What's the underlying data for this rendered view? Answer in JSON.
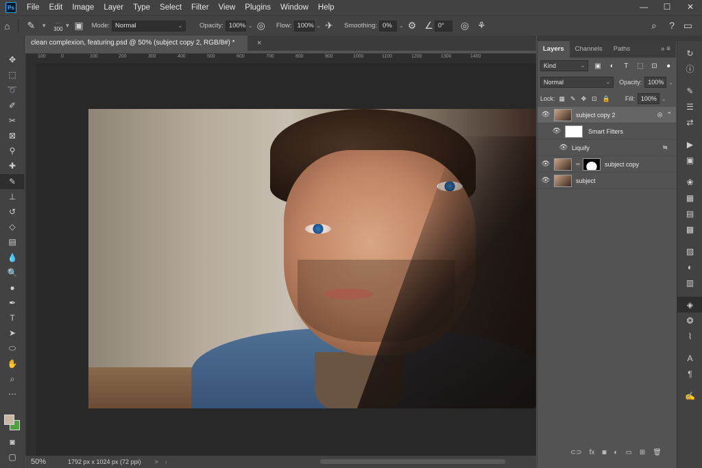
{
  "app": {
    "logo": "Ps"
  },
  "menu": [
    "File",
    "Edit",
    "Image",
    "Layer",
    "Type",
    "Select",
    "Filter",
    "View",
    "Plugins",
    "Window",
    "Help"
  ],
  "window_controls": [
    "—",
    "☐",
    "✕"
  ],
  "options": {
    "brush_size": "300",
    "mode_label": "Mode:",
    "mode_value": "Normal",
    "opacity_label": "Opacity:",
    "opacity_value": "100%",
    "flow_label": "Flow:",
    "flow_value": "100%",
    "smoothing_label": "Smoothing:",
    "smoothing_value": "0%",
    "angle_value": "0°"
  },
  "document": {
    "tab_title": "clean complexion, featuring.psd @ 50% (subject copy 2, RGB/8#) *",
    "close": "×"
  },
  "ruler_ticks": [
    "100",
    "0",
    "100",
    "200",
    "300",
    "400",
    "500",
    "600",
    "700",
    "800",
    "900",
    "1000",
    "1100",
    "1200",
    "1300",
    "1400"
  ],
  "status": {
    "zoom": "50%",
    "doc_info": "1792 px x 1024 px (72 ppi)",
    "nav_arrow": ">"
  },
  "layers_panel": {
    "tabs": [
      "Layers",
      "Channels",
      "Paths"
    ],
    "filter_kind": "Kind",
    "blend_mode": "Normal",
    "opacity_label": "Opacity:",
    "opacity_value": "100%",
    "lock_label": "Lock:",
    "fill_label": "Fill:",
    "fill_value": "100%",
    "layers": [
      {
        "name": "subject copy 2",
        "selected": true
      },
      {
        "name": "Smart Filters"
      },
      {
        "name": "Liquify"
      },
      {
        "name": "subject copy"
      },
      {
        "name": "subject"
      }
    ]
  },
  "colors": {
    "foreground": "#c5b9a4",
    "background": "#49a33a",
    "accent": "#31a8ff"
  }
}
